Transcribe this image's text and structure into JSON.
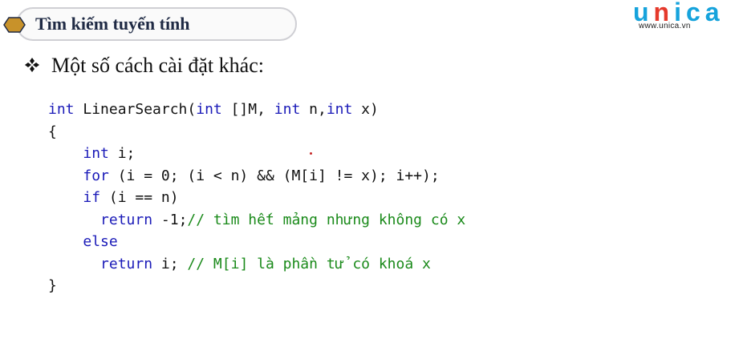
{
  "header": {
    "title": "Tìm kiếm tuyến tính"
  },
  "logo": {
    "letters": [
      "u",
      "n",
      "i",
      "c",
      "a"
    ],
    "url": "www.unica.vn",
    "colors": {
      "blue": "#16a3dc",
      "red": "#e5392b"
    }
  },
  "section": {
    "bullet_icon": "diamond-bullet-icon",
    "subtitle": "Một số cách cài đặt khác:"
  },
  "code": {
    "keyword_color": "#1a1ab8",
    "comment_color": "#1a8a1a",
    "lines": [
      [
        [
          "kw",
          "int"
        ],
        [
          "t",
          " LinearSearch("
        ],
        [
          "kw",
          "int"
        ],
        [
          "t",
          " []M, "
        ],
        [
          "kw",
          "int"
        ],
        [
          "t",
          " n,"
        ],
        [
          "kw",
          "int"
        ],
        [
          "t",
          " x)"
        ]
      ],
      [
        [
          "t",
          "{"
        ]
      ],
      [
        [
          "t",
          "    "
        ],
        [
          "kw",
          "int"
        ],
        [
          "t",
          " i;"
        ]
      ],
      [
        [
          "t",
          "    "
        ],
        [
          "kw",
          "for"
        ],
        [
          "t",
          " (i = 0; (i < n) && (M[i] != x); i++);"
        ]
      ],
      [
        [
          "t",
          "    "
        ],
        [
          "kw",
          "if"
        ],
        [
          "t",
          " (i == n)"
        ]
      ],
      [
        [
          "t",
          "      "
        ],
        [
          "kw",
          "return"
        ],
        [
          "t",
          " -1;"
        ],
        [
          "cm",
          "// tìm hết mảng nhưng không có x"
        ]
      ],
      [
        [
          "t",
          "    "
        ],
        [
          "kw",
          "else"
        ]
      ],
      [
        [
          "t",
          "      "
        ],
        [
          "kw",
          "return"
        ],
        [
          "t",
          " i; "
        ],
        [
          "cm",
          "// M[i] là phần tử có khoá x"
        ]
      ],
      [
        [
          "t",
          "}"
        ]
      ]
    ]
  }
}
